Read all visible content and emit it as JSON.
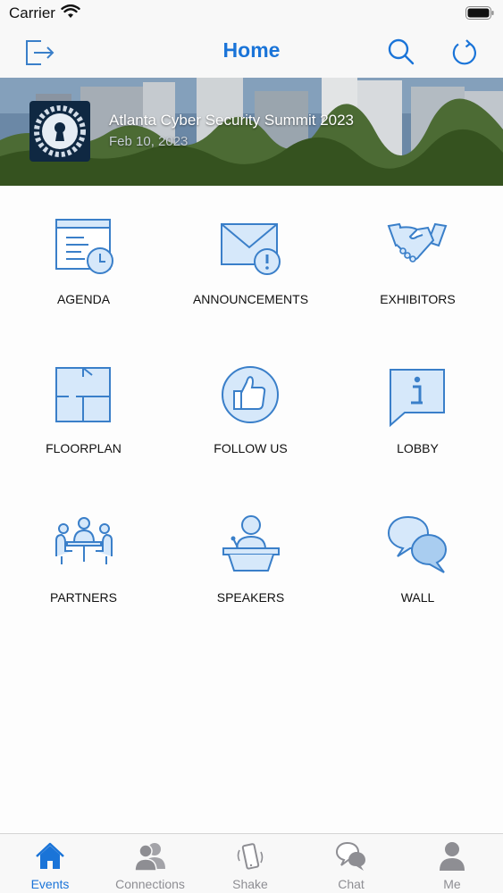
{
  "status": {
    "carrier": "Carrier"
  },
  "nav": {
    "title": "Home"
  },
  "event": {
    "title": "Atlanta Cyber Security Summit 2023",
    "date": "Feb 10, 2023"
  },
  "grid": [
    {
      "label": "AGENDA",
      "icon": "agenda-icon"
    },
    {
      "label": "ANNOUNCEMENTS",
      "icon": "announcements-icon"
    },
    {
      "label": "EXHIBITORS",
      "icon": "handshake-icon"
    },
    {
      "label": "FLOORPLAN",
      "icon": "floorplan-icon"
    },
    {
      "label": "FOLLOW US",
      "icon": "thumbs-up-icon"
    },
    {
      "label": "LOBBY",
      "icon": "info-icon"
    },
    {
      "label": "PARTNERS",
      "icon": "meeting-icon"
    },
    {
      "label": "SPEAKERS",
      "icon": "podium-icon"
    },
    {
      "label": "WALL",
      "icon": "chat-bubbles-icon"
    }
  ],
  "tabs": [
    {
      "label": "Events",
      "icon": "home-icon",
      "active": true
    },
    {
      "label": "Connections",
      "icon": "people-icon"
    },
    {
      "label": "Shake",
      "icon": "phone-shake-icon"
    },
    {
      "label": "Chat",
      "icon": "chat-icon"
    },
    {
      "label": "Me",
      "icon": "person-icon"
    }
  ],
  "colors": {
    "accent": "#1a74d8",
    "icon_stroke": "#3a7fc9",
    "icon_fill": "#d6e8fa",
    "tab_inactive": "#8e8e93"
  }
}
